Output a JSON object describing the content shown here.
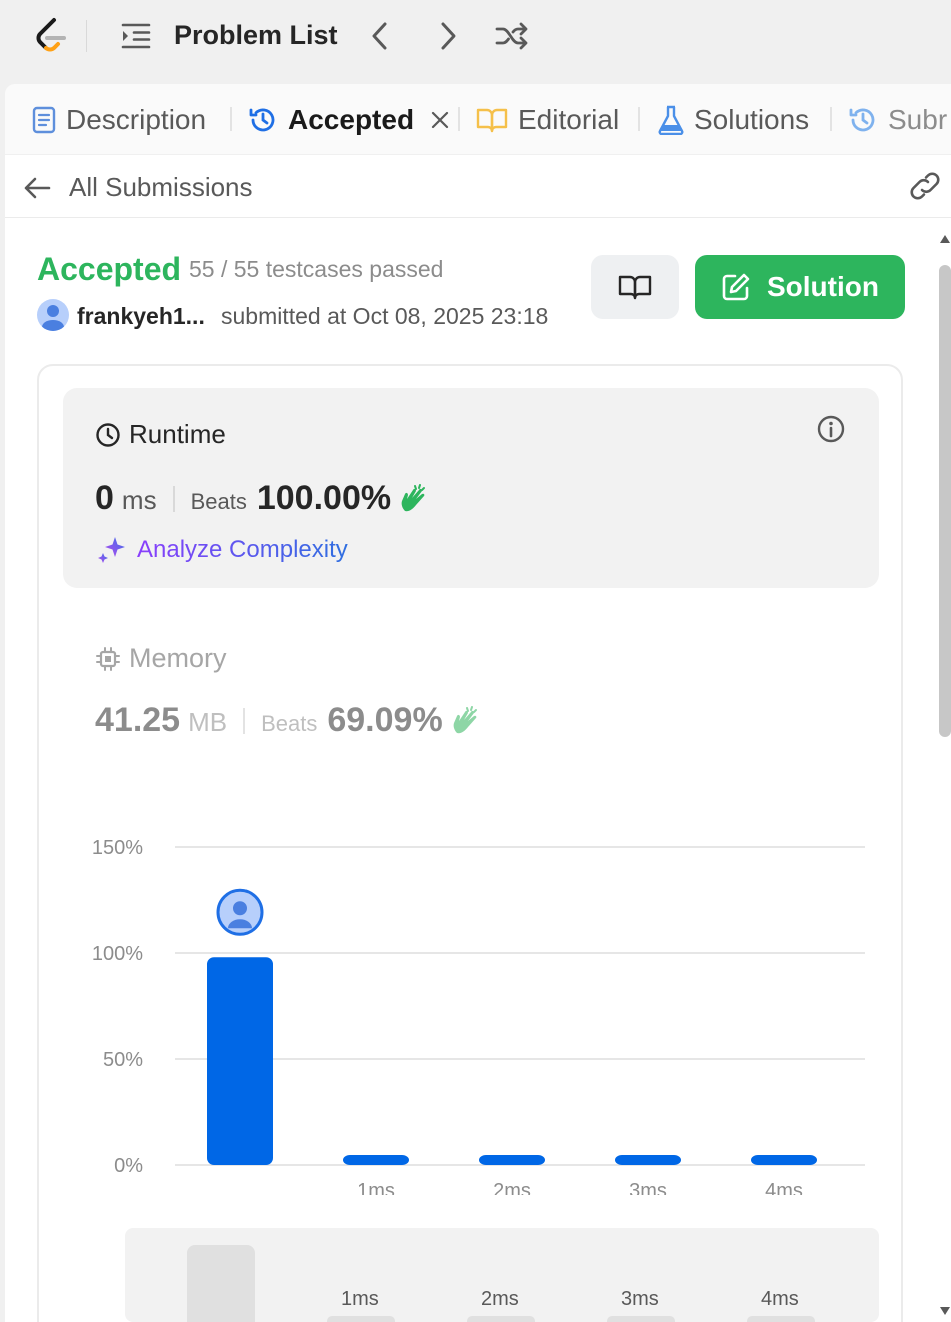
{
  "topbar": {
    "problem_list": "Problem List"
  },
  "tabs": [
    {
      "label": "Description",
      "icon": "description-icon"
    },
    {
      "label": "Accepted",
      "icon": "history-icon"
    },
    {
      "label": "Editorial",
      "icon": "book-icon"
    },
    {
      "label": "Solutions",
      "icon": "flask-icon"
    },
    {
      "label": "Subr",
      "icon": "history-icon"
    }
  ],
  "subheader": {
    "back_label": "All Submissions"
  },
  "result": {
    "status": "Accepted",
    "testcases": "55 / 55 testcases passed",
    "username": "frankyeh1...",
    "submitted": "submitted at Oct 08, 2025 23:18",
    "solution_button": "Solution"
  },
  "runtime": {
    "label": "Runtime",
    "value": "0",
    "unit": "ms",
    "beats_label": "Beats",
    "beats_value": "100.00%",
    "analyze_label": "Analyze Complexity"
  },
  "memory": {
    "label": "Memory",
    "value": "41.25",
    "unit": "MB",
    "beats_label": "Beats",
    "beats_value": "69.09%"
  },
  "colors": {
    "accent_green": "#2db55d",
    "bar_blue": "#0067e6",
    "clap_green": "#2db55d"
  },
  "chart_data": {
    "type": "bar",
    "categories": [
      "",
      "1ms",
      "2ms",
      "3ms",
      "4ms"
    ],
    "values": [
      98,
      0,
      0,
      0,
      0
    ],
    "yticks": [
      "150%",
      "100%",
      "50%",
      "0%"
    ],
    "ylim": [
      0,
      150
    ],
    "grid": true
  },
  "mini_chart": {
    "labels": [
      "1ms",
      "2ms",
      "3ms",
      "4ms"
    ]
  }
}
